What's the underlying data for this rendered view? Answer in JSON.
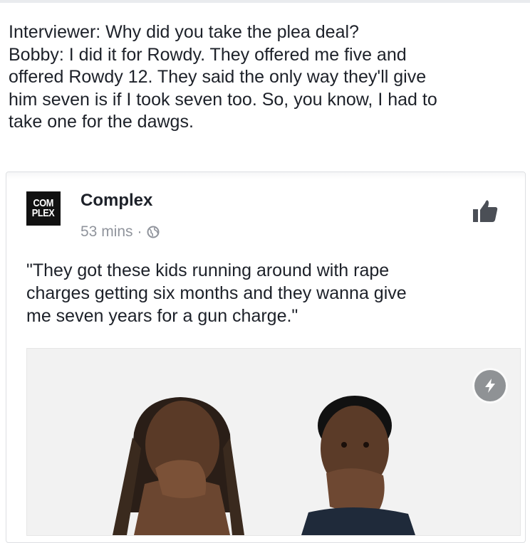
{
  "status": {
    "lines": [
      "Interviewer: Why did you take the plea deal?",
      "Bobby: I did it for Rowdy. They offered me five and",
      "offered Rowdy 12. They said the only way they'll give",
      "him seven is if I took seven too. So, you know, I had to",
      "take one for the dawgs."
    ]
  },
  "shared_post": {
    "logo_lines": [
      "COM",
      "PLEX"
    ],
    "page_name": "Complex",
    "timestamp": "53 mins",
    "separator": "·",
    "privacy_icon": "globe-icon",
    "like_icon": "thumbs-up-icon",
    "quote_lines": [
      "\"They got these kids running around with rape",
      "charges getting six months and they wanna give",
      "me seven years for a gun charge.\""
    ],
    "badge_icon": "lightning-bolt-icon"
  },
  "colors": {
    "text": "#1d2129",
    "meta": "#90949c",
    "logo_bg": "#111111",
    "badge_bg": "#8f9295",
    "like_icon": "#4b4f56"
  }
}
